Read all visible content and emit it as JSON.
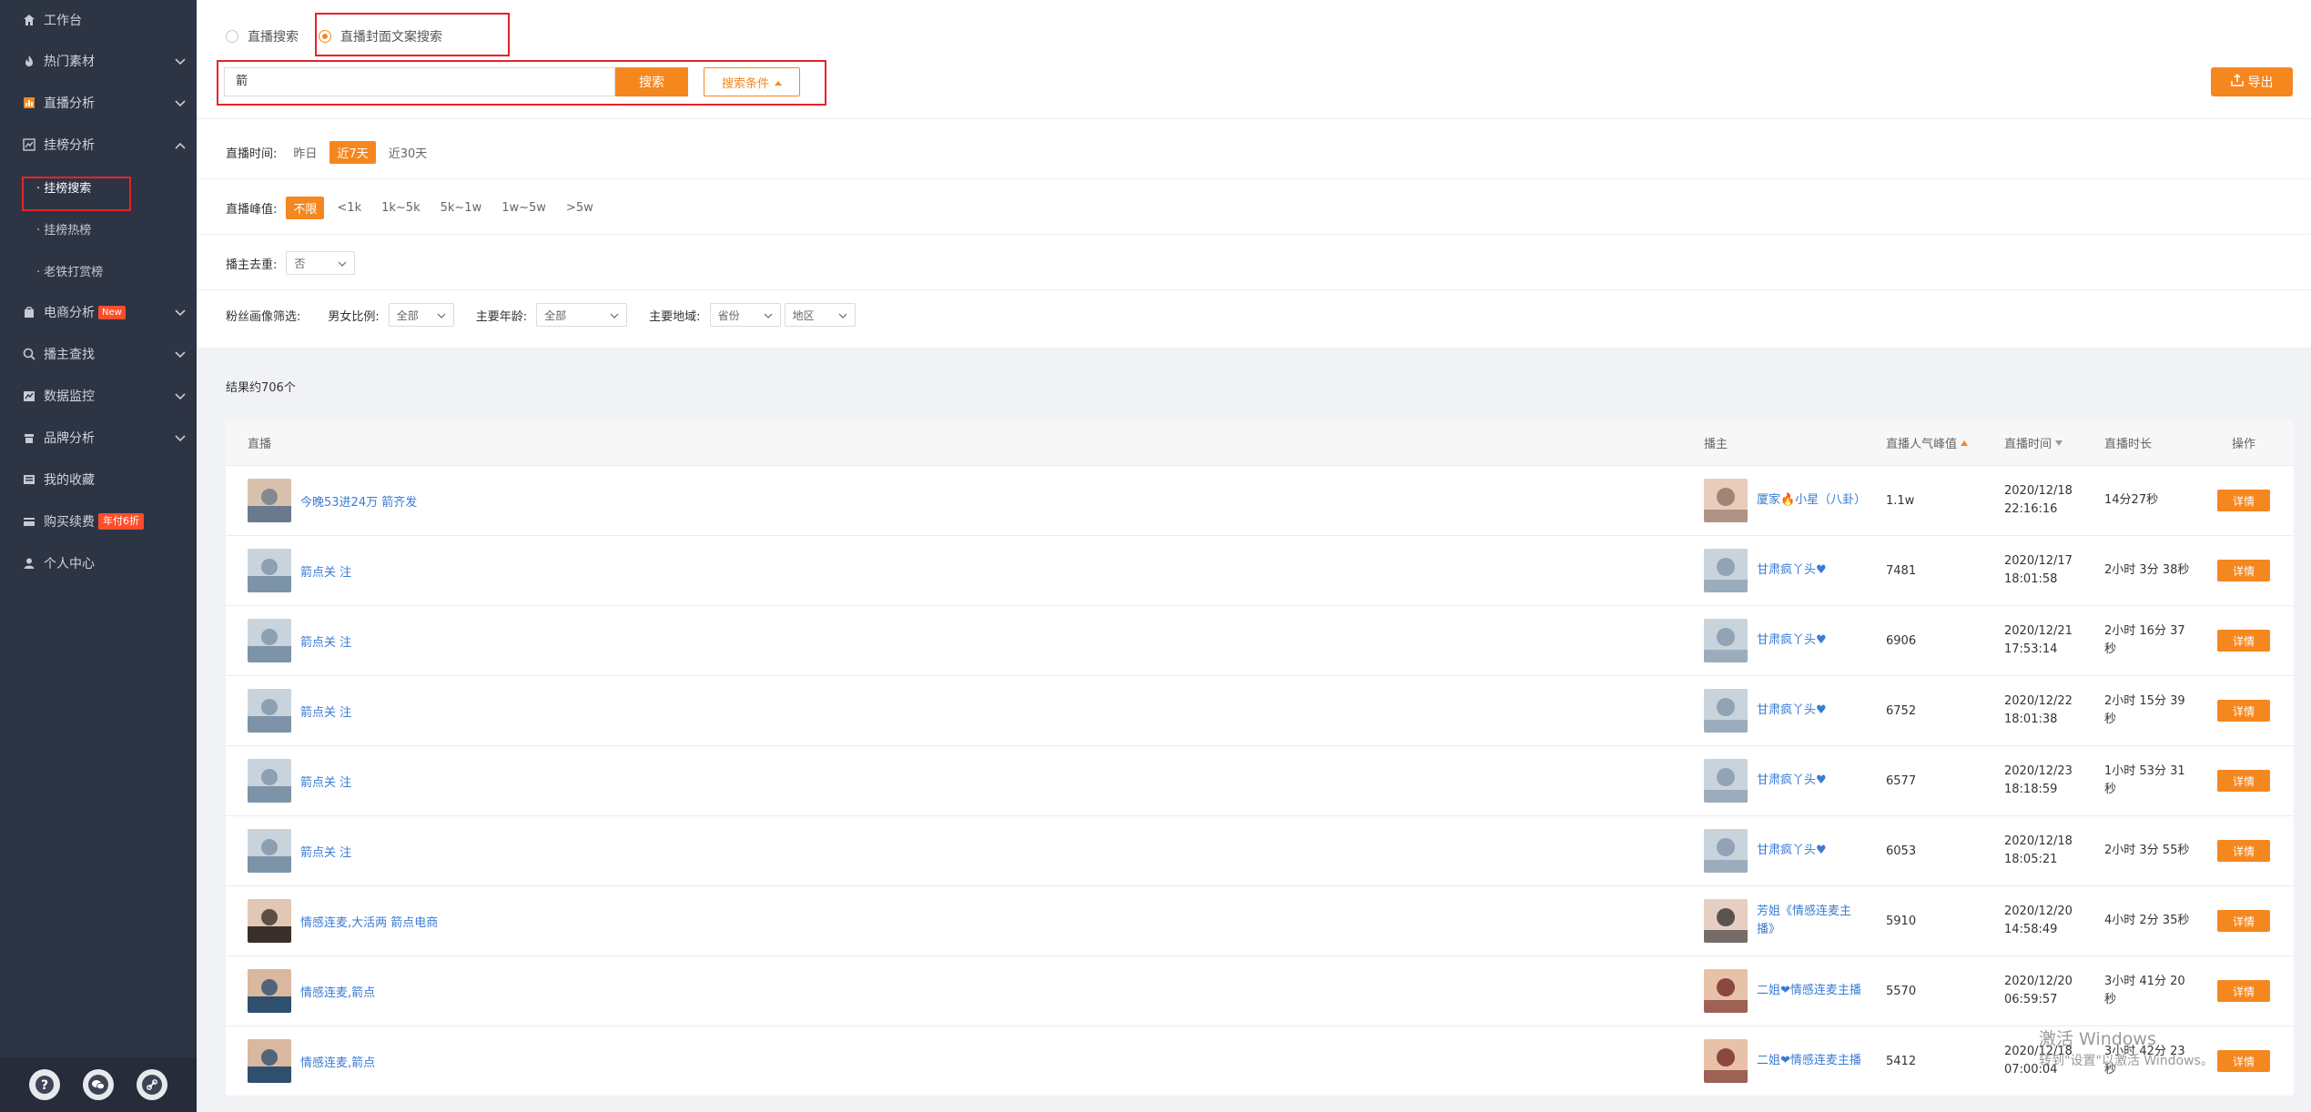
{
  "sidebar": {
    "items": [
      {
        "label": "工作台",
        "icon": "home-icon"
      },
      {
        "label": "热门素材",
        "icon": "fire-icon"
      },
      {
        "label": "直播分析",
        "icon": "bar-chart-icon"
      },
      {
        "label": "挂榜分析",
        "icon": "trend-chart-icon"
      }
    ],
    "sub_items": [
      "· 挂榜搜索",
      "· 挂榜热榜",
      "· 老铁打赏榜"
    ],
    "items2": [
      {
        "label": "电商分析",
        "icon": "shop-icon",
        "badge": "New"
      },
      {
        "label": "播主查找",
        "icon": "search-icon"
      },
      {
        "label": "数据监控",
        "icon": "monitor-icon"
      },
      {
        "label": "品牌分析",
        "icon": "brand-icon"
      },
      {
        "label": "我的收藏",
        "icon": "favorites-icon"
      },
      {
        "label": "购买续费",
        "icon": "cart-icon",
        "badge": "年付6折"
      },
      {
        "label": "个人中心",
        "icon": "user-icon"
      }
    ],
    "footer_icons": [
      "help-icon",
      "wechat-icon",
      "link-icon"
    ]
  },
  "search": {
    "mode_1": "直播搜索",
    "mode_2": "直播封面文案搜索",
    "value": "箭",
    "button": "搜索",
    "conditions": "搜索条件",
    "export": "导出"
  },
  "filters": {
    "time_label": "直播时间:",
    "time_options": [
      "昨日",
      "近7天",
      "近30天"
    ],
    "peak_label": "直播峰值:",
    "peak_options": [
      "不限",
      "<1k",
      "1k~5k",
      "5k~1w",
      "1w~5w",
      ">5w"
    ],
    "dedupe_label": "播主去重:",
    "dedupe_value": "否",
    "fans_label": "粉丝画像筛选:",
    "gender_label": "男女比例:",
    "gender_value": "全部",
    "age_label": "主要年龄:",
    "age_value": "全部",
    "region_label": "主要地域:",
    "province_value": "省份",
    "area_value": "地区"
  },
  "results": {
    "count_text": "结果约706个"
  },
  "table": {
    "headers": {
      "live": "直播",
      "host": "播主",
      "peak": "直播人气峰值",
      "time": "直播时间",
      "duration": "直播时长",
      "action": "操作"
    },
    "rows": [
      {
        "title": "今晚53进24万 箭齐发",
        "host": "厦家🔥小星（八卦）",
        "peak": "1.1w",
        "date": "2020/12/18",
        "clock": "22:16:16",
        "duration": "14分27秒",
        "action": "详情"
      },
      {
        "title": "箭点关 注",
        "host": "甘肃疯丫头♥",
        "peak": "7481",
        "date": "2020/12/17",
        "clock": "18:01:58",
        "duration": "2小时 3分 38秒",
        "action": "详情"
      },
      {
        "title": "箭点关 注",
        "host": "甘肃疯丫头♥",
        "peak": "6906",
        "date": "2020/12/21",
        "clock": "17:53:14",
        "duration": "2小时 16分 37秒",
        "action": "详情"
      },
      {
        "title": "箭点关 注",
        "host": "甘肃疯丫头♥",
        "peak": "6752",
        "date": "2020/12/22",
        "clock": "18:01:38",
        "duration": "2小时 15分 39秒",
        "action": "详情"
      },
      {
        "title": "箭点关 注",
        "host": "甘肃疯丫头♥",
        "peak": "6577",
        "date": "2020/12/23",
        "clock": "18:18:59",
        "duration": "1小时 53分 31秒",
        "action": "详情"
      },
      {
        "title": "箭点关 注",
        "host": "甘肃疯丫头♥",
        "peak": "6053",
        "date": "2020/12/18",
        "clock": "18:05:21",
        "duration": "2小时 3分 55秒",
        "action": "详情"
      },
      {
        "title": "情感连麦,大活两 箭点电商",
        "host": "芳姐《情感连麦主播》",
        "peak": "5910",
        "date": "2020/12/20",
        "clock": "14:58:49",
        "duration": "4小时 2分 35秒",
        "action": "详情"
      },
      {
        "title": "情感连麦,箭点",
        "host": "二姐❤情感连麦主播",
        "peak": "5570",
        "date": "2020/12/20",
        "clock": "06:59:57",
        "duration": "3小时 41分 20秒",
        "action": "详情"
      },
      {
        "title": "情感连麦,箭点",
        "host": "二姐❤情感连麦主播",
        "peak": "5412",
        "date": "2020/12/18",
        "clock": "07:00:04",
        "duration": "3小时 42分 23秒",
        "action": "详情"
      }
    ]
  },
  "watermark": {
    "line1": "激活 Windows",
    "line2": "转到\"设置\"以激活 Windows。"
  },
  "colors": {
    "accent": "#f5871f",
    "sidebar_bg": "#2d3444",
    "link": "#3a7bd5",
    "highlight_box": "#e5232a"
  }
}
